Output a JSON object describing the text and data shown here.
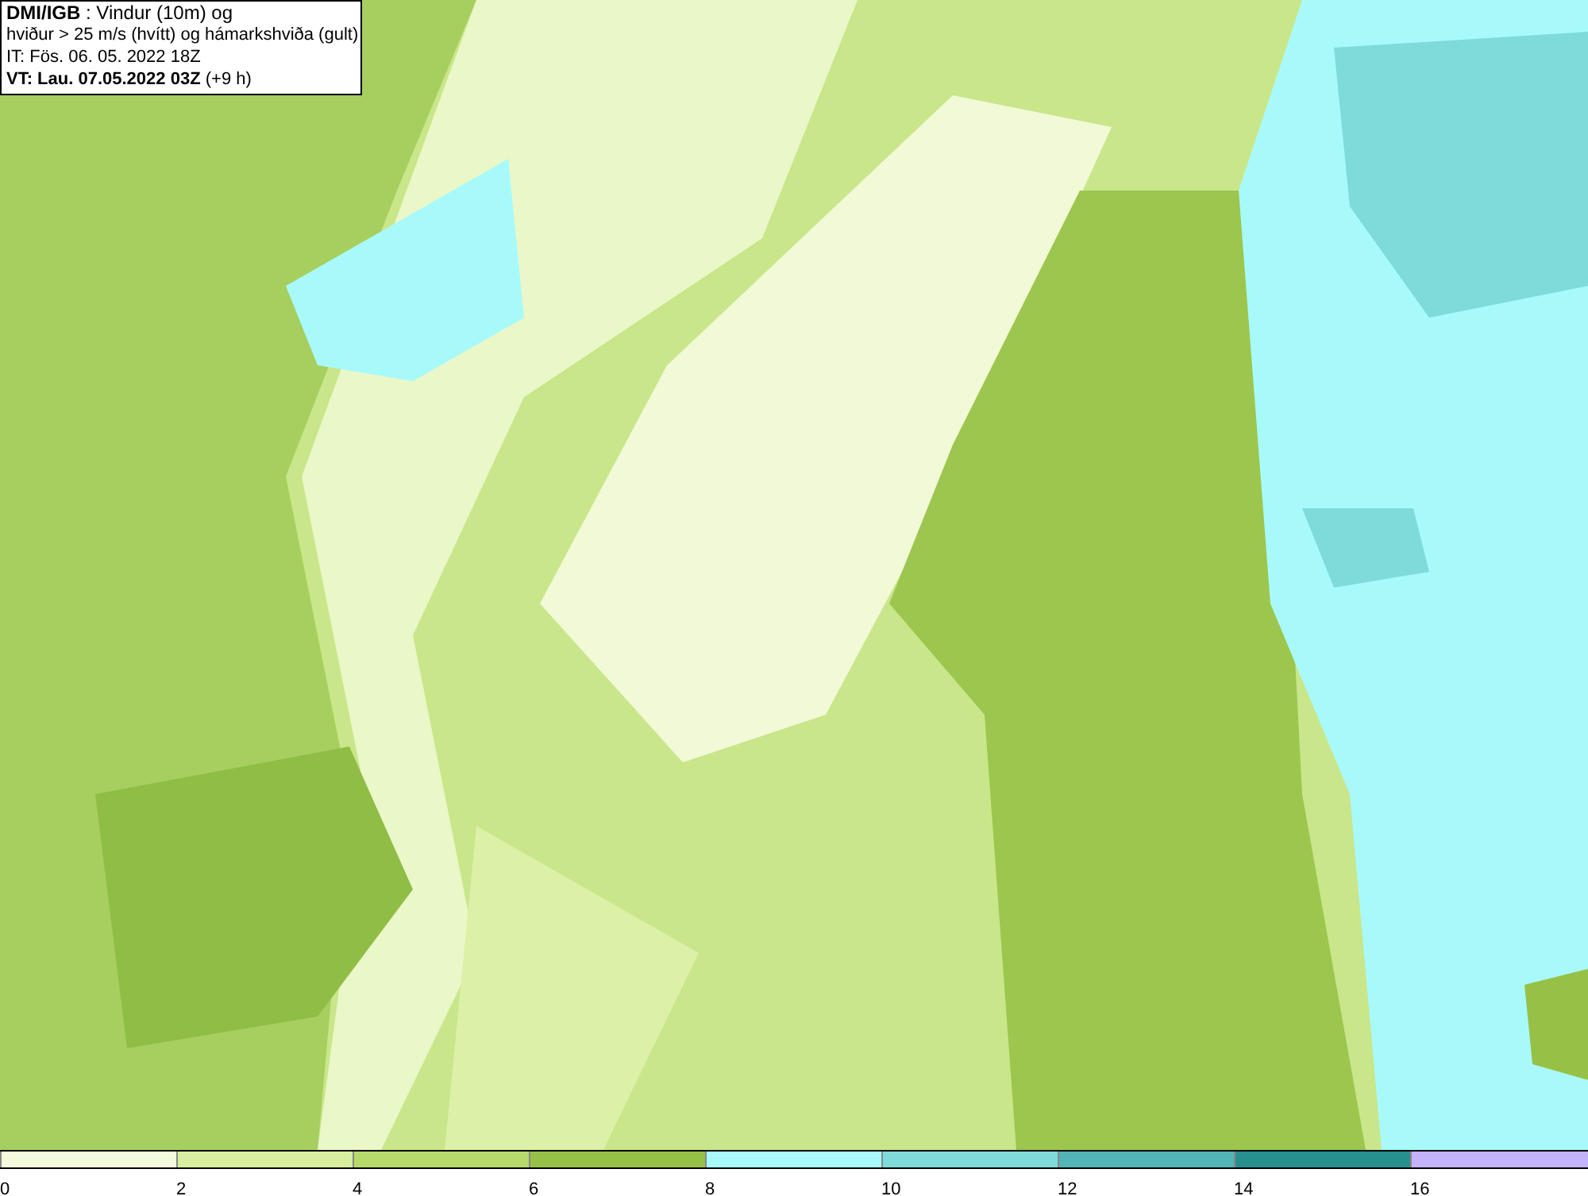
{
  "header": {
    "lines": [
      "**DMI/IGB** : Vindur (10m) og",
      "hviður > 25 m/s (hvítt) og hámarkshviða (gult)",
      "IT: Fös. 06. 05. 2022 18Z",
      "**VT: Lau. 07.05.2022 03Z** (+9 h)"
    ]
  },
  "legend": {
    "swatches": [
      {
        "color": "#f4fbdc"
      },
      {
        "color": "#d7ee9f"
      },
      {
        "color": "#b6d96c"
      },
      {
        "color": "#97c146"
      },
      {
        "color": "#a8fafa"
      },
      {
        "color": "#7fdada"
      },
      {
        "color": "#52b4b4"
      },
      {
        "color": "#288f8f"
      },
      {
        "color": "#c3b3fb"
      }
    ],
    "ticks": [
      "0",
      "2",
      "4",
      "6",
      "8",
      "10",
      "12",
      "14",
      "16"
    ]
  }
}
